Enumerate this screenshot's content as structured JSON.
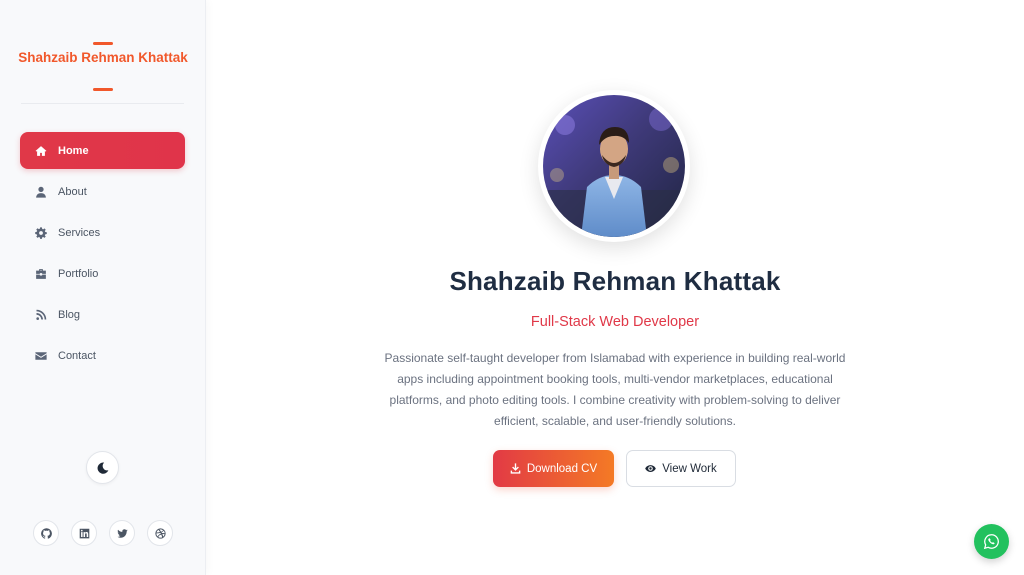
{
  "brand": {
    "name": "Shahzaib Rehman Khattak",
    "accent": "#f1582b"
  },
  "nav": {
    "items": [
      {
        "label": "Home",
        "icon": "home-icon",
        "active": true
      },
      {
        "label": "About",
        "icon": "user-icon",
        "active": false
      },
      {
        "label": "Services",
        "icon": "gear-icon",
        "active": false
      },
      {
        "label": "Portfolio",
        "icon": "briefcase-icon",
        "active": false
      },
      {
        "label": "Blog",
        "icon": "blog-icon",
        "active": false
      },
      {
        "label": "Contact",
        "icon": "envelope-icon",
        "active": false
      }
    ]
  },
  "theme_toggle": {
    "icon": "moon-icon"
  },
  "socials": [
    {
      "name": "github",
      "icon": "github-icon"
    },
    {
      "name": "linkedin",
      "icon": "linkedin-icon"
    },
    {
      "name": "twitter",
      "icon": "twitter-icon"
    },
    {
      "name": "dribbble",
      "icon": "dribbble-icon"
    }
  ],
  "hero": {
    "name": "Shahzaib Rehman Khattak",
    "role": "Full-Stack Web Developer",
    "description": "Passionate self-taught developer from Islamabad with experience in building real-world apps including appointment booking tools, multi-vendor marketplaces, educational platforms, and photo editing tools. I combine creativity with problem-solving to deliver efficient, scalable, and user-friendly solutions.",
    "primary_button": "Download CV",
    "secondary_button": "View Work"
  },
  "whatsapp": {
    "icon": "whatsapp-icon",
    "color": "#22c15e"
  },
  "colors": {
    "accent_red": "#e03848",
    "accent_orange": "#f47a25",
    "sidebar_bg": "#f8f9fb"
  }
}
